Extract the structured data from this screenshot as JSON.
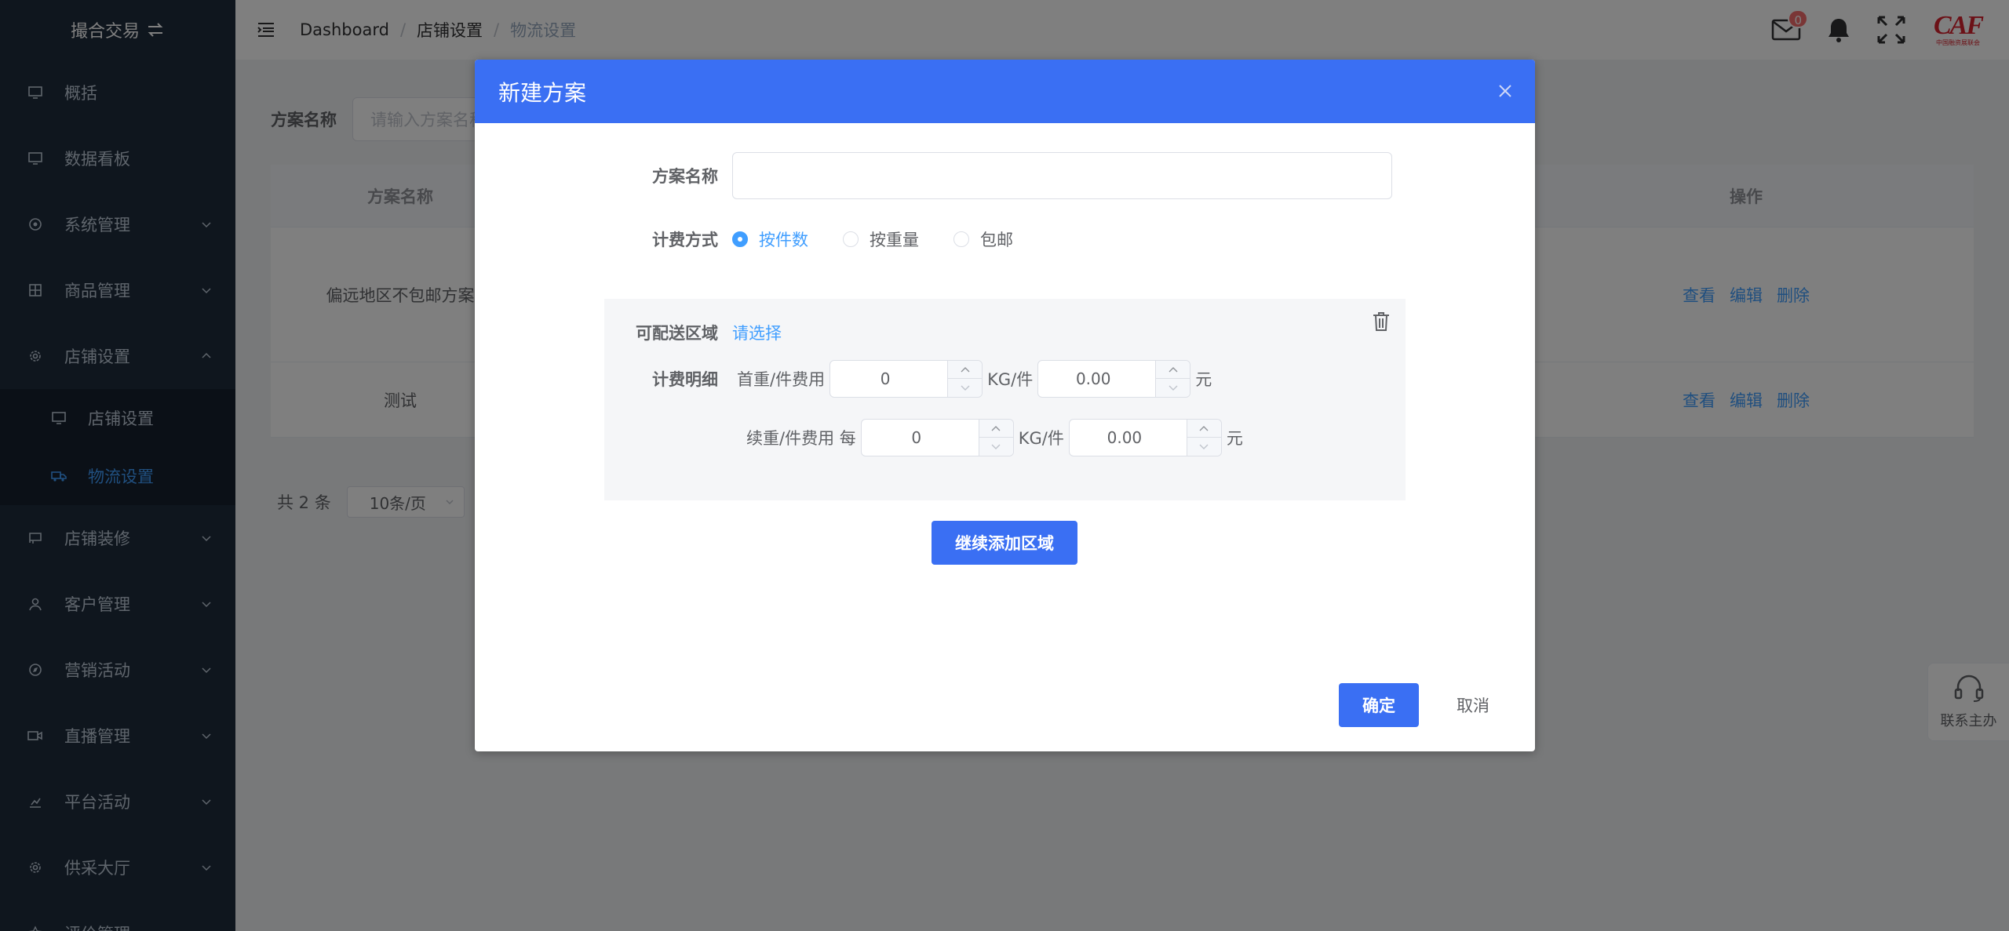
{
  "sidebar": {
    "brand": "撮合交易",
    "items": [
      {
        "label": "概括",
        "icon": "monitor-icon",
        "has_arrow": false
      },
      {
        "label": "数据看板",
        "icon": "monitor-icon",
        "has_arrow": false
      },
      {
        "label": "系统管理",
        "icon": "settings-icon",
        "has_arrow": true
      },
      {
        "label": "商品管理",
        "icon": "grid-icon",
        "has_arrow": true
      },
      {
        "label": "店铺设置",
        "icon": "gear-icon",
        "has_arrow": true,
        "expanded": true
      }
    ],
    "submenu": [
      {
        "label": "店铺设置",
        "icon": "monitor-icon"
      },
      {
        "label": "物流设置",
        "icon": "truck-icon",
        "active": true
      }
    ],
    "items_after": [
      {
        "label": "店铺装修",
        "icon": "shop-icon"
      },
      {
        "label": "客户管理",
        "icon": "user-icon"
      },
      {
        "label": "营销活动",
        "icon": "compass-icon"
      },
      {
        "label": "直播管理",
        "icon": "video-icon"
      },
      {
        "label": "平台活动",
        "icon": "chart-icon"
      },
      {
        "label": "供采大厅",
        "icon": "gear-icon"
      },
      {
        "label": "评价管理",
        "icon": "star-icon"
      }
    ]
  },
  "header": {
    "breadcrumb": [
      "Dashboard",
      "店铺设置",
      "物流设置"
    ],
    "mail_badge": "0",
    "logo_text": "CAF",
    "logo_sub": "中国融资展联会"
  },
  "filter": {
    "label": "方案名称",
    "placeholder": "请输入方案名称"
  },
  "table": {
    "col_name": "方案名称",
    "col_ops": "操作",
    "rows": [
      {
        "name": "偏远地区不包邮方案",
        "ops": [
          "查看",
          "编辑",
          "删除"
        ]
      },
      {
        "name": "测试",
        "ops": [
          "查看",
          "编辑",
          "删除"
        ]
      }
    ]
  },
  "pager": {
    "total": "共 2 条",
    "page_size": "10条/页"
  },
  "float_contact": {
    "label": "联系主办"
  },
  "dialog": {
    "title": "新建方案",
    "name_label": "方案名称",
    "name_value": "",
    "billing_label": "计费方式",
    "billing_options": [
      "按件数",
      "按重量",
      "包邮"
    ],
    "billing_selected": 0,
    "region_label": "可配送区域",
    "region_link": "请选择",
    "detail_label": "计费明细",
    "first_label": "首重/件费用",
    "first_qty": "0",
    "unit1": "KG/件",
    "first_fee": "0.00",
    "currency": "元",
    "cont_label": "续重/件费用 每",
    "cont_qty": "0",
    "unit2": "KG/件",
    "cont_fee": "0.00",
    "add_area_btn": "继续添加区域",
    "ok_btn": "确定",
    "cancel_btn": "取消"
  },
  "colors": {
    "sidebar_bg": "#1f2d3d",
    "primary": "#3a6ff3",
    "link": "#409eff",
    "badge": "#f56c6c",
    "logo_red": "#d9232e"
  }
}
